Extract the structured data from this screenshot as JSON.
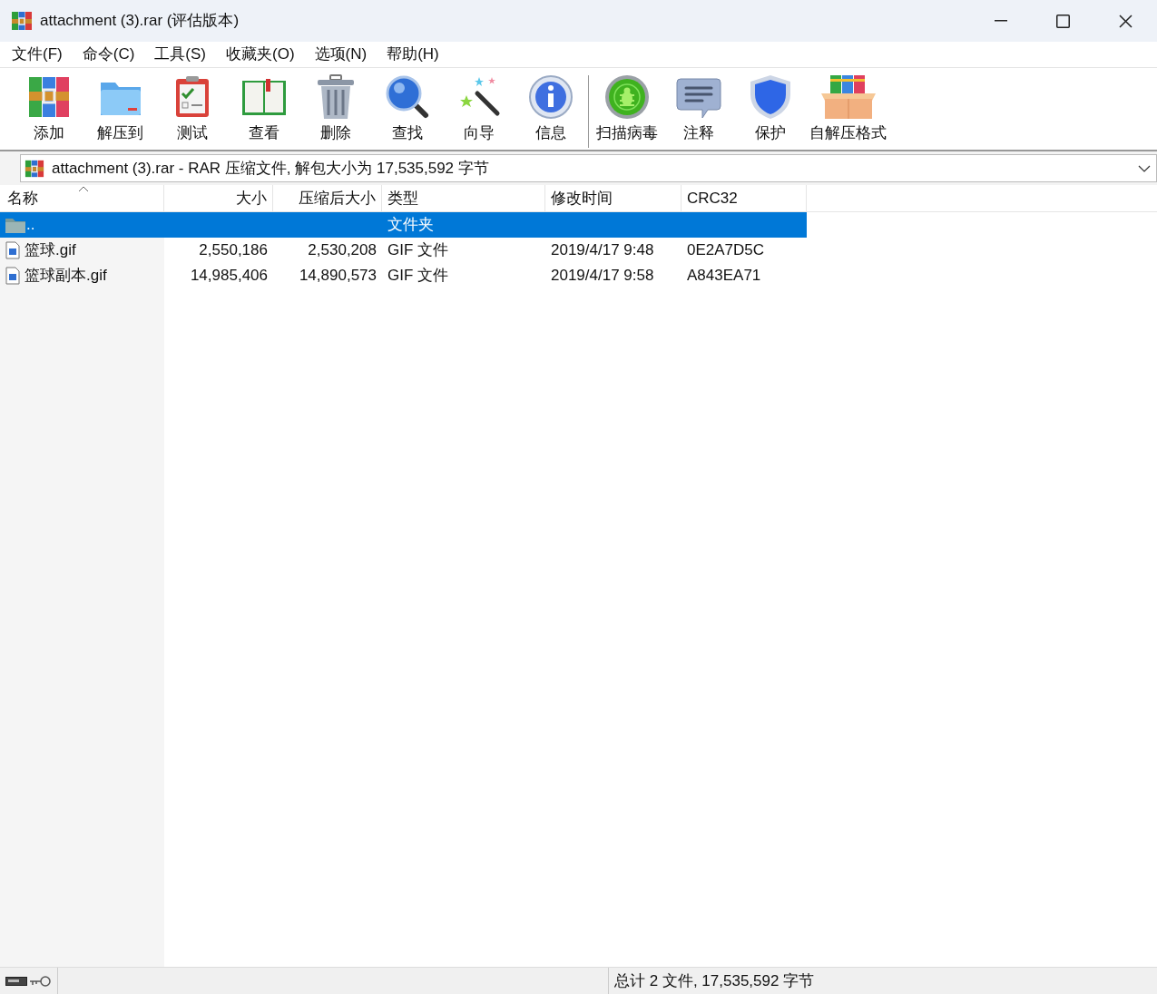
{
  "window": {
    "title": "attachment (3).rar (评估版本)"
  },
  "menu": [
    "文件(F)",
    "命令(C)",
    "工具(S)",
    "收藏夹(O)",
    "选项(N)",
    "帮助(H)"
  ],
  "toolbar": [
    {
      "kind": "add",
      "label": "添加"
    },
    {
      "kind": "extract",
      "label": "解压到"
    },
    {
      "kind": "test",
      "label": "测试"
    },
    {
      "kind": "view",
      "label": "查看"
    },
    {
      "kind": "delete",
      "label": "删除"
    },
    {
      "kind": "find",
      "label": "查找"
    },
    {
      "kind": "wizard",
      "label": "向导"
    },
    {
      "kind": "info",
      "label": "信息"
    },
    {
      "kind": "virus",
      "label": "扫描病毒"
    },
    {
      "kind": "comment",
      "label": "注释"
    },
    {
      "kind": "protect",
      "label": "保护"
    },
    {
      "kind": "sfx",
      "label": "自解压格式"
    }
  ],
  "address": "attachment (3).rar - RAR 压缩文件, 解包大小为 17,535,592 字节",
  "table": {
    "columns": [
      "名称",
      "大小",
      "压缩后大小",
      "类型",
      "修改时间",
      "CRC32"
    ],
    "rows": [
      {
        "kind": "folder",
        "selected": true,
        "cells": [
          "..",
          "",
          "",
          "文件夹",
          "",
          ""
        ]
      },
      {
        "kind": "file",
        "selected": false,
        "cells": [
          "篮球.gif",
          "2,550,186",
          "2,530,208",
          "GIF 文件",
          "2019/4/17 9:48",
          "0E2A7D5C"
        ]
      },
      {
        "kind": "file",
        "selected": false,
        "cells": [
          "篮球副本.gif",
          "14,985,406",
          "14,890,573",
          "GIF 文件",
          "2019/4/17 9:58",
          "A843EA71"
        ]
      }
    ]
  },
  "status_bar": "总计 2 文件, 17,535,592 字节"
}
